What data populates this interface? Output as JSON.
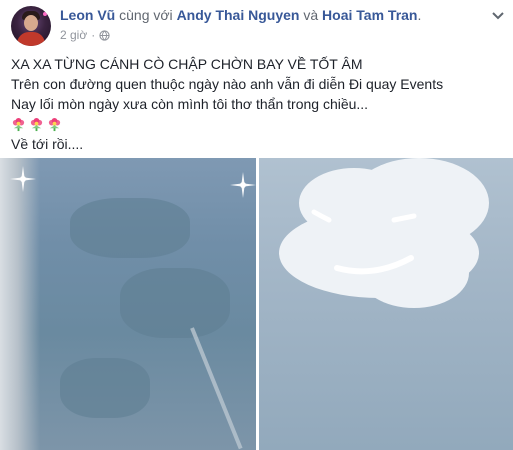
{
  "post": {
    "author": "Leon Vũ",
    "with_text": " cùng với ",
    "tag1": "Andy Thai Nguyen",
    "and_text": " và ",
    "tag2": "Hoai Tam Tran",
    "period": ".",
    "timestamp": "2 giờ",
    "dot": "·",
    "lines": [
      "XA XA TỪNG CÁNH CÒ CHẬP CHỜN BAY VỀ TỐT ÂM",
      "Trên con đường quen thuộc ngày nào anh vẫn đi diễn Đi quay Events",
      "Nay lối mòn ngày xưa còn mình tôi thơ thẩn trong chiều...",
      "Về tới rồi...."
    ],
    "emoji": [
      "flower-bouquet",
      "flower-bouquet",
      "flower-bouquet"
    ]
  },
  "icons": {
    "privacy": "globe-icon",
    "menu": "chevron-down-icon"
  },
  "colors": {
    "link": "#385898",
    "secondary_text": "#616770",
    "timestamp": "#90949c"
  }
}
